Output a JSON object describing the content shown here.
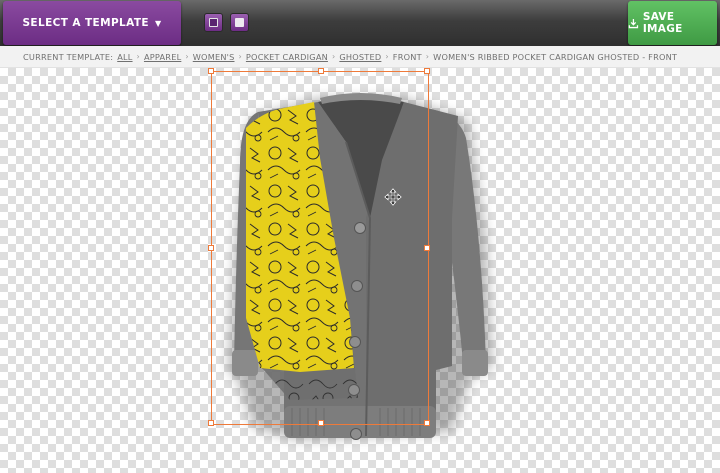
{
  "toolbar": {
    "select_template_label": "SELECT A TEMPLATE",
    "select_template_caret": "⌄",
    "save_image_label": "SAVE IMAGE",
    "save_icon": "download-tray-icon"
  },
  "breadcrumb": {
    "prefix": "CURRENT TEMPLATE:",
    "links": [
      "ALL",
      "APPAREL",
      "WOMEN'S",
      "POCKET CARDIGAN",
      "GHOSTED"
    ],
    "view": "FRONT",
    "current": "WOMEN'S RIBBED POCKET CARDIGAN GHOSTED - FRONT",
    "separator": "›"
  },
  "canvas": {
    "garment_color": "#717171",
    "design_color": "#e6cf1b",
    "selection_color": "#ee7a3a",
    "move_cursor_icon": "move-arrows-icon"
  },
  "colors": {
    "toolbar_bg": "#3d3d3d",
    "select_button": "#7b3b93",
    "save_button": "#4fae53"
  }
}
